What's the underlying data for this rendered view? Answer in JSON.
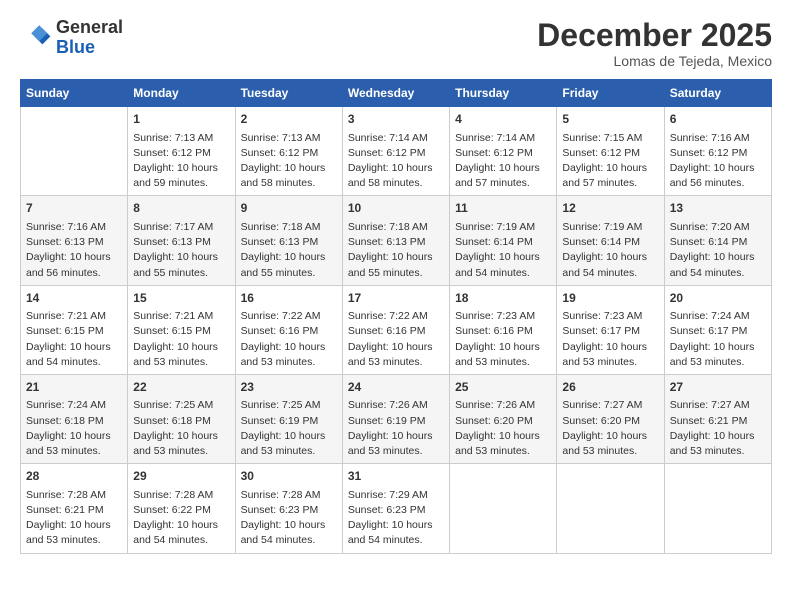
{
  "header": {
    "logo_line1": "General",
    "logo_line2": "Blue",
    "month": "December 2025",
    "location": "Lomas de Tejeda, Mexico"
  },
  "columns": [
    "Sunday",
    "Monday",
    "Tuesday",
    "Wednesday",
    "Thursday",
    "Friday",
    "Saturday"
  ],
  "weeks": [
    [
      {
        "day": "",
        "sunrise": "",
        "sunset": "",
        "daylight": ""
      },
      {
        "day": "1",
        "sunrise": "Sunrise: 7:13 AM",
        "sunset": "Sunset: 6:12 PM",
        "daylight": "Daylight: 10 hours and 59 minutes."
      },
      {
        "day": "2",
        "sunrise": "Sunrise: 7:13 AM",
        "sunset": "Sunset: 6:12 PM",
        "daylight": "Daylight: 10 hours and 58 minutes."
      },
      {
        "day": "3",
        "sunrise": "Sunrise: 7:14 AM",
        "sunset": "Sunset: 6:12 PM",
        "daylight": "Daylight: 10 hours and 58 minutes."
      },
      {
        "day": "4",
        "sunrise": "Sunrise: 7:14 AM",
        "sunset": "Sunset: 6:12 PM",
        "daylight": "Daylight: 10 hours and 57 minutes."
      },
      {
        "day": "5",
        "sunrise": "Sunrise: 7:15 AM",
        "sunset": "Sunset: 6:12 PM",
        "daylight": "Daylight: 10 hours and 57 minutes."
      },
      {
        "day": "6",
        "sunrise": "Sunrise: 7:16 AM",
        "sunset": "Sunset: 6:12 PM",
        "daylight": "Daylight: 10 hours and 56 minutes."
      }
    ],
    [
      {
        "day": "7",
        "sunrise": "Sunrise: 7:16 AM",
        "sunset": "Sunset: 6:13 PM",
        "daylight": "Daylight: 10 hours and 56 minutes."
      },
      {
        "day": "8",
        "sunrise": "Sunrise: 7:17 AM",
        "sunset": "Sunset: 6:13 PM",
        "daylight": "Daylight: 10 hours and 55 minutes."
      },
      {
        "day": "9",
        "sunrise": "Sunrise: 7:18 AM",
        "sunset": "Sunset: 6:13 PM",
        "daylight": "Daylight: 10 hours and 55 minutes."
      },
      {
        "day": "10",
        "sunrise": "Sunrise: 7:18 AM",
        "sunset": "Sunset: 6:13 PM",
        "daylight": "Daylight: 10 hours and 55 minutes."
      },
      {
        "day": "11",
        "sunrise": "Sunrise: 7:19 AM",
        "sunset": "Sunset: 6:14 PM",
        "daylight": "Daylight: 10 hours and 54 minutes."
      },
      {
        "day": "12",
        "sunrise": "Sunrise: 7:19 AM",
        "sunset": "Sunset: 6:14 PM",
        "daylight": "Daylight: 10 hours and 54 minutes."
      },
      {
        "day": "13",
        "sunrise": "Sunrise: 7:20 AM",
        "sunset": "Sunset: 6:14 PM",
        "daylight": "Daylight: 10 hours and 54 minutes."
      }
    ],
    [
      {
        "day": "14",
        "sunrise": "Sunrise: 7:21 AM",
        "sunset": "Sunset: 6:15 PM",
        "daylight": "Daylight: 10 hours and 54 minutes."
      },
      {
        "day": "15",
        "sunrise": "Sunrise: 7:21 AM",
        "sunset": "Sunset: 6:15 PM",
        "daylight": "Daylight: 10 hours and 53 minutes."
      },
      {
        "day": "16",
        "sunrise": "Sunrise: 7:22 AM",
        "sunset": "Sunset: 6:16 PM",
        "daylight": "Daylight: 10 hours and 53 minutes."
      },
      {
        "day": "17",
        "sunrise": "Sunrise: 7:22 AM",
        "sunset": "Sunset: 6:16 PM",
        "daylight": "Daylight: 10 hours and 53 minutes."
      },
      {
        "day": "18",
        "sunrise": "Sunrise: 7:23 AM",
        "sunset": "Sunset: 6:16 PM",
        "daylight": "Daylight: 10 hours and 53 minutes."
      },
      {
        "day": "19",
        "sunrise": "Sunrise: 7:23 AM",
        "sunset": "Sunset: 6:17 PM",
        "daylight": "Daylight: 10 hours and 53 minutes."
      },
      {
        "day": "20",
        "sunrise": "Sunrise: 7:24 AM",
        "sunset": "Sunset: 6:17 PM",
        "daylight": "Daylight: 10 hours and 53 minutes."
      }
    ],
    [
      {
        "day": "21",
        "sunrise": "Sunrise: 7:24 AM",
        "sunset": "Sunset: 6:18 PM",
        "daylight": "Daylight: 10 hours and 53 minutes."
      },
      {
        "day": "22",
        "sunrise": "Sunrise: 7:25 AM",
        "sunset": "Sunset: 6:18 PM",
        "daylight": "Daylight: 10 hours and 53 minutes."
      },
      {
        "day": "23",
        "sunrise": "Sunrise: 7:25 AM",
        "sunset": "Sunset: 6:19 PM",
        "daylight": "Daylight: 10 hours and 53 minutes."
      },
      {
        "day": "24",
        "sunrise": "Sunrise: 7:26 AM",
        "sunset": "Sunset: 6:19 PM",
        "daylight": "Daylight: 10 hours and 53 minutes."
      },
      {
        "day": "25",
        "sunrise": "Sunrise: 7:26 AM",
        "sunset": "Sunset: 6:20 PM",
        "daylight": "Daylight: 10 hours and 53 minutes."
      },
      {
        "day": "26",
        "sunrise": "Sunrise: 7:27 AM",
        "sunset": "Sunset: 6:20 PM",
        "daylight": "Daylight: 10 hours and 53 minutes."
      },
      {
        "day": "27",
        "sunrise": "Sunrise: 7:27 AM",
        "sunset": "Sunset: 6:21 PM",
        "daylight": "Daylight: 10 hours and 53 minutes."
      }
    ],
    [
      {
        "day": "28",
        "sunrise": "Sunrise: 7:28 AM",
        "sunset": "Sunset: 6:21 PM",
        "daylight": "Daylight: 10 hours and 53 minutes."
      },
      {
        "day": "29",
        "sunrise": "Sunrise: 7:28 AM",
        "sunset": "Sunset: 6:22 PM",
        "daylight": "Daylight: 10 hours and 54 minutes."
      },
      {
        "day": "30",
        "sunrise": "Sunrise: 7:28 AM",
        "sunset": "Sunset: 6:23 PM",
        "daylight": "Daylight: 10 hours and 54 minutes."
      },
      {
        "day": "31",
        "sunrise": "Sunrise: 7:29 AM",
        "sunset": "Sunset: 6:23 PM",
        "daylight": "Daylight: 10 hours and 54 minutes."
      },
      {
        "day": "",
        "sunrise": "",
        "sunset": "",
        "daylight": ""
      },
      {
        "day": "",
        "sunrise": "",
        "sunset": "",
        "daylight": ""
      },
      {
        "day": "",
        "sunrise": "",
        "sunset": "",
        "daylight": ""
      }
    ]
  ]
}
